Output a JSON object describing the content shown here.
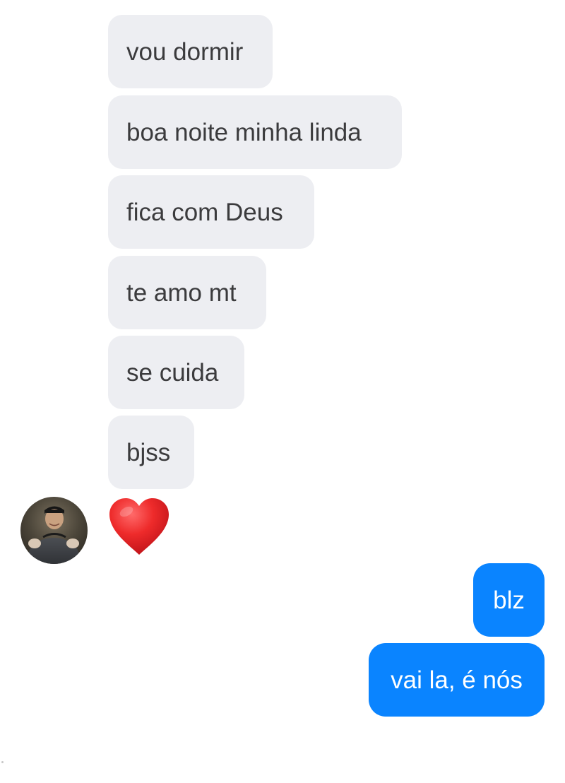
{
  "conversation": {
    "incoming": [
      {
        "text": "vou dormir"
      },
      {
        "text": "boa noite minha linda"
      },
      {
        "text": "fica com Deus"
      },
      {
        "text": "te amo mt"
      },
      {
        "text": "se cuida"
      },
      {
        "text": "bjss"
      }
    ],
    "reaction_icon": "heart-icon",
    "avatar_icon": "profile-photo",
    "outgoing": [
      {
        "text": "blz"
      },
      {
        "text": "vai la, é nós"
      }
    ]
  },
  "colors": {
    "incoming_bubble": "#edeef2",
    "incoming_text": "#3b3b3d",
    "outgoing_bubble": "#0a84ff",
    "outgoing_text": "#ffffff",
    "heart": "#ee2b2b"
  }
}
